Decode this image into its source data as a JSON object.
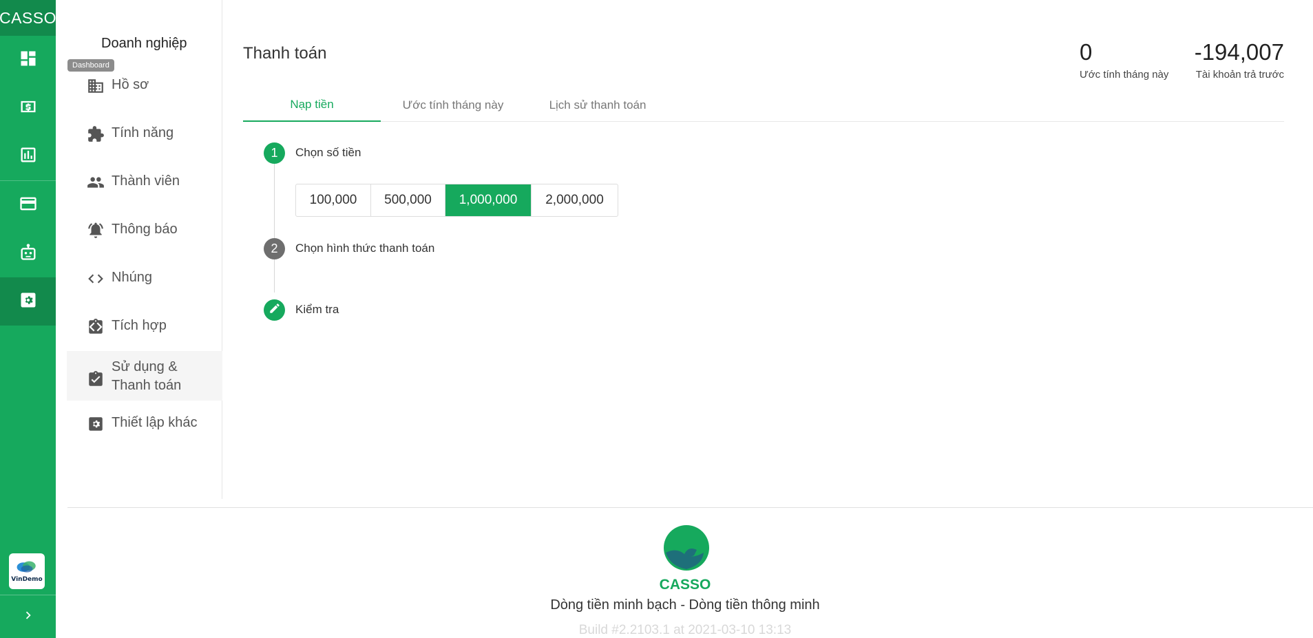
{
  "rail": {
    "brand": "CASSO",
    "items": [
      {
        "icon": "dashboard-icon",
        "name": "Dashboard"
      },
      {
        "icon": "money-icon",
        "name": "Money"
      },
      {
        "icon": "report-icon",
        "name": "Report"
      },
      {
        "icon": "card-icon",
        "name": "Card"
      },
      {
        "icon": "robot-icon",
        "name": "Bot"
      },
      {
        "icon": "settings-icon",
        "name": "Settings"
      }
    ],
    "logo_label": "VinDemo",
    "accent": "#16a95d"
  },
  "tooltip": "Dashboard",
  "submenu": {
    "title": "Doanh nghiệp",
    "items": [
      {
        "label": "Hồ sơ",
        "icon": "building-icon"
      },
      {
        "label": "Tính năng",
        "icon": "puzzle-icon"
      },
      {
        "label": "Thành viên",
        "icon": "people-icon"
      },
      {
        "label": "Thông báo",
        "icon": "bell-icon"
      },
      {
        "label": "Nhúng",
        "icon": "code-icon"
      },
      {
        "label": "Tích hợp",
        "icon": "integration-icon"
      },
      {
        "label": "Sử dụng & Thanh toán",
        "icon": "clipboard-check-icon"
      },
      {
        "label": "Thiết lập khác",
        "icon": "settings-box-icon"
      }
    ]
  },
  "main": {
    "title": "Thanh toán",
    "stats": [
      {
        "value": "0",
        "label": "Ước tính tháng này"
      },
      {
        "value": "-194,007",
        "label": "Tài khoản trả trước"
      }
    ],
    "tabs": [
      "Nạp tiền",
      "Ước tính tháng này",
      "Lịch sử thanh toán"
    ],
    "steps": [
      {
        "number": "1",
        "label": "Chọn số tiền"
      },
      {
        "number": "2",
        "label": "Chọn hình thức thanh toán"
      },
      {
        "number": "",
        "label": "Kiểm tra"
      }
    ],
    "amounts": [
      "100,000",
      "500,000",
      "1,000,000",
      "2,000,000"
    ],
    "selected_amount": "1,000,000"
  },
  "footer": {
    "brand": "CASSO",
    "tagline": "Dòng tiền minh bạch - Dòng tiền thông minh",
    "build": "Build #2.2103.1 at 2021-03-10 13:13"
  }
}
